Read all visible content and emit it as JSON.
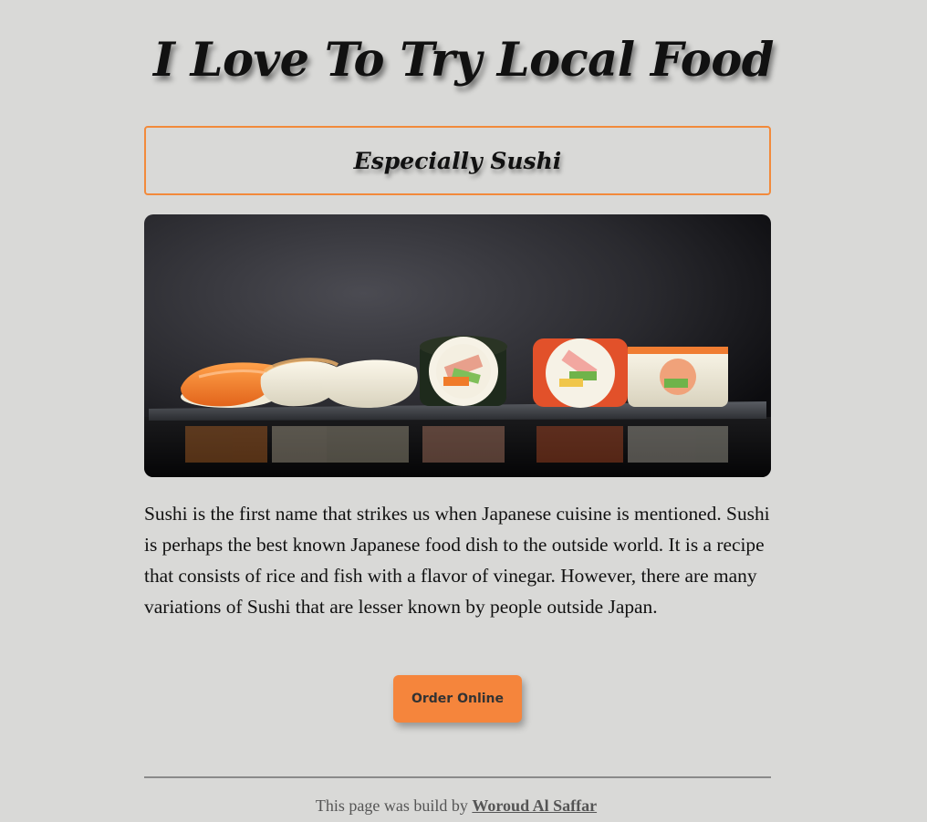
{
  "header": {
    "title": "I Love To Try Local Food",
    "subtitle": "Especially Sushi"
  },
  "hero": {
    "alt": "Sushi"
  },
  "content": {
    "paragraph": "Sushi is the first name that strikes us when Japanese cuisine is mentioned. Sushi is perhaps the best known Japanese food dish to the outside world. It is a recipe that consists of rice and fish with a flavor of vinegar. However, there are many variations of Sushi that are lesser known by people outside Japan."
  },
  "cta": {
    "label": "Order Online"
  },
  "footer": {
    "prefix": "This page was build by ",
    "author": "Woroud Al Saffar"
  },
  "colors": {
    "background": "#d9d9d7",
    "accent": "#f5853c",
    "border": "#f28a3b"
  }
}
